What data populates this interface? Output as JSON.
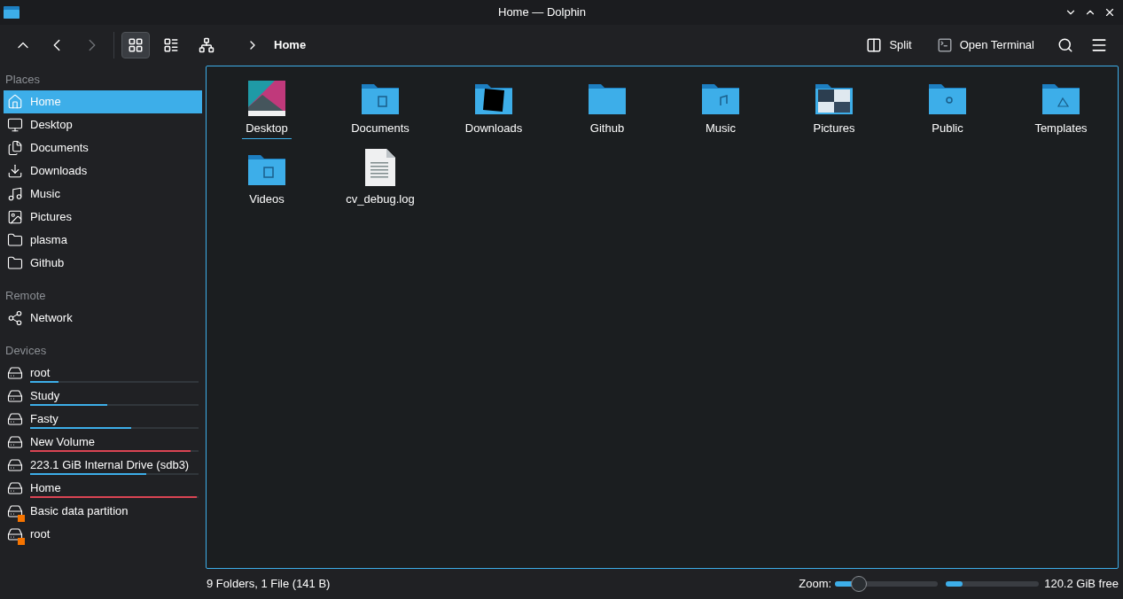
{
  "window": {
    "title": "Home — Dolphin"
  },
  "toolbar": {
    "view_modes": [
      {
        "kind": "icons",
        "selected": true
      },
      {
        "kind": "compact",
        "selected": false
      },
      {
        "kind": "details",
        "selected": false
      }
    ],
    "breadcrumb": "Home",
    "split": "Split",
    "terminal": "Open Terminal"
  },
  "sidebar": {
    "sections": [
      {
        "title": "Places",
        "items": [
          {
            "kind": "home",
            "label": "Home",
            "selected": true
          },
          {
            "kind": "desktop",
            "label": "Desktop",
            "selected": false
          },
          {
            "kind": "documents",
            "label": "Documents",
            "selected": false
          },
          {
            "kind": "downloads",
            "label": "Downloads",
            "selected": false
          },
          {
            "kind": "music",
            "label": "Music",
            "selected": false
          },
          {
            "kind": "pictures",
            "label": "Pictures",
            "selected": false
          },
          {
            "kind": "folder",
            "label": "plasma",
            "selected": false
          },
          {
            "kind": "folder",
            "label": "Github",
            "selected": false
          }
        ]
      },
      {
        "title": "Remote",
        "items": [
          {
            "kind": "network",
            "label": "Network",
            "selected": false
          }
        ]
      },
      {
        "title": "Devices",
        "items": [
          {
            "kind": "system",
            "label": "root",
            "selected": false,
            "level": 0.17,
            "color": "#3daee9"
          },
          {
            "kind": "drive",
            "label": "Study",
            "selected": false,
            "level": 0.46,
            "color": "#3daee9"
          },
          {
            "kind": "drive",
            "label": "Fasty",
            "selected": false,
            "level": 0.6,
            "color": "#3daee9"
          },
          {
            "kind": "drive",
            "label": "New Volume",
            "selected": false,
            "level": 0.95,
            "color": "#da4453"
          },
          {
            "kind": "drive",
            "label": "223.1 GiB Internal Drive (sdb3)",
            "selected": false,
            "level": 0.69,
            "color": "#3daee9"
          },
          {
            "kind": "drive",
            "label": "Home",
            "selected": false,
            "level": 0.99,
            "color": "#da4453"
          },
          {
            "kind": "unmounted",
            "label": "Basic data partition",
            "selected": false
          },
          {
            "kind": "unmounted",
            "label": "root",
            "selected": false
          }
        ]
      }
    ]
  },
  "files": [
    {
      "kind": "desktop",
      "name": "Desktop",
      "focused": true
    },
    {
      "kind": "documents",
      "name": "Documents",
      "focused": false
    },
    {
      "kind": "downloads",
      "name": "Downloads",
      "focused": false
    },
    {
      "kind": "folder",
      "name": "Github",
      "focused": false
    },
    {
      "kind": "music",
      "name": "Music",
      "focused": false
    },
    {
      "kind": "pictures",
      "name": "Pictures",
      "focused": false
    },
    {
      "kind": "public",
      "name": "Public",
      "focused": false
    },
    {
      "kind": "templates",
      "name": "Templates",
      "focused": false
    },
    {
      "kind": "videos",
      "name": "Videos",
      "focused": false
    },
    {
      "kind": "file",
      "name": "cv_debug.log",
      "focused": false
    }
  ],
  "status_bar": {
    "summary": "9 Folders, 1 File (141 B)",
    "zoom_label": "Zoom:",
    "zoom": {
      "level": 0.23
    },
    "space": {
      "level": 0.18
    },
    "free": "120.2 GiB free"
  }
}
